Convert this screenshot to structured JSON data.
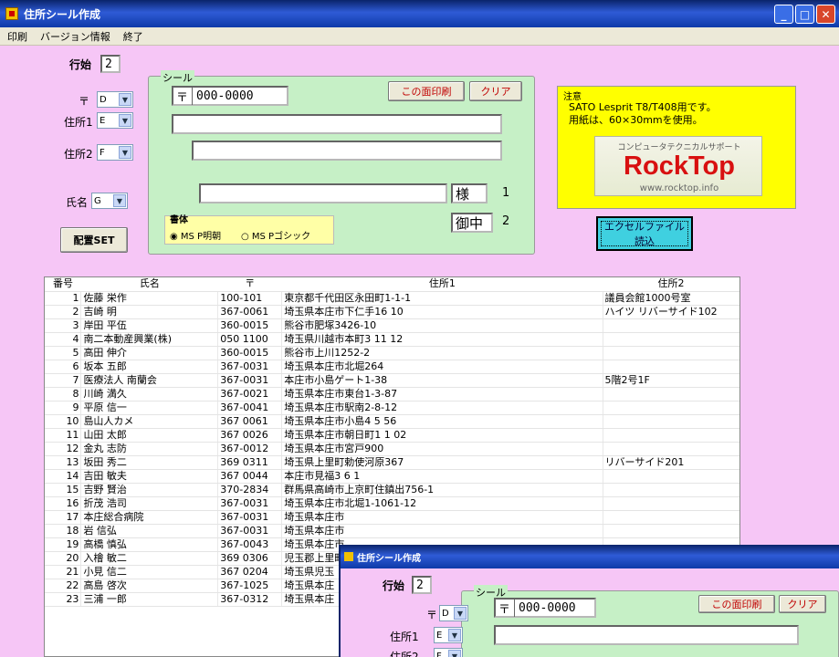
{
  "window": {
    "title": "住所シール作成"
  },
  "menu": [
    "印刷",
    "バージョン情報",
    "終了"
  ],
  "form": {
    "start_row_label": "行始",
    "start_row_value": "2",
    "postal_label": "〒",
    "postal_combo": "D",
    "addr1_label": "住所1",
    "addr1_combo": "E",
    "addr2_label": "住所2",
    "addr2_combo": "F",
    "name_label": "氏名",
    "name_combo": "G",
    "placement_button": "配置SET"
  },
  "seal": {
    "group_title": "シール",
    "postal_mark": "〒",
    "postal_value": "000-0000",
    "print_button": "この面印刷",
    "clear_button": "クリア",
    "addr1_value": "",
    "addr2_value": "",
    "name_value": "",
    "honorific1": "様",
    "honorific1_num": "1",
    "honorific2": "御中",
    "honorific2_num": "2",
    "font_group_title": "書体",
    "font_opt1": "MS P明朝",
    "font_opt2": "MS Pゴシック"
  },
  "notice": {
    "title": "注意",
    "line1": "SATO Lesprit T8/T408用です。",
    "line2": "用紙は、60×30mmを使用。",
    "ad_top": "コンピュータテクニカルサポート",
    "ad_logo": "RockTop",
    "ad_url": "www.rocktop.info"
  },
  "excel_button": {
    "line1": "エクセルファイル",
    "line2": "読込"
  },
  "table": {
    "headers": [
      "番号",
      "氏名",
      "〒",
      "住所1",
      "住所2"
    ],
    "rows": [
      [
        "1",
        "佐藤 栄作",
        "100-101",
        "東京都千代田区永田町1-1-1",
        "議員会館1000号室"
      ],
      [
        "2",
        "吉崎 明",
        "367-0061",
        "埼玉県本庄市下仁手16 10",
        "ハイツ リバーサイド102"
      ],
      [
        "3",
        "岸田 平伍",
        "360-0015",
        "熊谷市肥塚3426-10",
        ""
      ],
      [
        "4",
        "南二本動産興業(株)",
        "050 1100",
        "埼玉県川越市本町3 11 12",
        ""
      ],
      [
        "5",
        "高田 伸介",
        "360-0015",
        "熊谷市上川1252-2",
        ""
      ],
      [
        "6",
        "坂本 五郎",
        "367-0031",
        "埼玉県本庄市北堀264",
        ""
      ],
      [
        "7",
        "医療法人 南蘭会",
        "367-0031",
        "本庄市小島ゲート1-38",
        "5階2号1F"
      ],
      [
        "8",
        "川崎 満久",
        "367-0021",
        "埼玉県本庄市東台1-3-87",
        ""
      ],
      [
        "9",
        "平原 信一",
        "367-0041",
        "埼玉県本庄市駅南2-8-12",
        ""
      ],
      [
        "10",
        "島山人カメ",
        "367 0061",
        "埼玉県本庄市小島4 5 56",
        ""
      ],
      [
        "11",
        "山田 太郎",
        "367 0026",
        "埼玉県本庄市朝日町1 1 02",
        ""
      ],
      [
        "12",
        "金丸 志防",
        "367-0012",
        "埼玉県本庄市宮戸900",
        ""
      ],
      [
        "13",
        "坂田 秀二",
        "369 0311",
        "埼玉県上里町勅使河原367",
        "リバーサイド201"
      ],
      [
        "14",
        "吉田 敏夫",
        "367 0044",
        "本庄市見福3 6 1",
        ""
      ],
      [
        "15",
        "吉野 賢治",
        "370-2834",
        "群馬県高崎市上京町住鎮出756-1",
        ""
      ],
      [
        "16",
        "折茂 浩司",
        "367-0031",
        "埼玉県本庄市北堀1-1061-12",
        ""
      ],
      [
        "17",
        "本庄総合病院",
        "367-0031",
        "埼玉県本庄市",
        ""
      ],
      [
        "18",
        "岩 信弘",
        "367-0031",
        "埼玉県本庄市",
        ""
      ],
      [
        "19",
        "高橋 慎弘",
        "367-0043",
        "埼玉県本庄市",
        ""
      ],
      [
        "20",
        "入檜 敏二",
        "369 0306",
        "児玉郡上里町",
        ""
      ],
      [
        "21",
        "小見 信二",
        "367 0204",
        "埼玉県児玉",
        ""
      ],
      [
        "22",
        "高島 啓次",
        "367-1025",
        "埼玉県本庄",
        ""
      ],
      [
        "23",
        "三浦 一郎",
        "367-0312",
        "埼玉県本庄",
        ""
      ]
    ]
  },
  "overlay": {
    "title": "住所シール作成",
    "start_row_label": "行始",
    "start_row_value": "2",
    "seal_title": "シール",
    "postal_label": "〒",
    "postal_combo": "D",
    "postal_mark": "〒",
    "postal_value": "000-0000",
    "print_button": "この面印刷",
    "clear_button": "クリア",
    "addr1_label": "住所1",
    "addr1_combo": "E",
    "addr2_label": "住所2",
    "addr2_combo": "F"
  },
  "colors": {
    "background": "#f6c6f6",
    "group": "#c6f0c6",
    "notice": "#ffff00",
    "excel": "#3fd0e0",
    "accent_red": "#c00000"
  }
}
